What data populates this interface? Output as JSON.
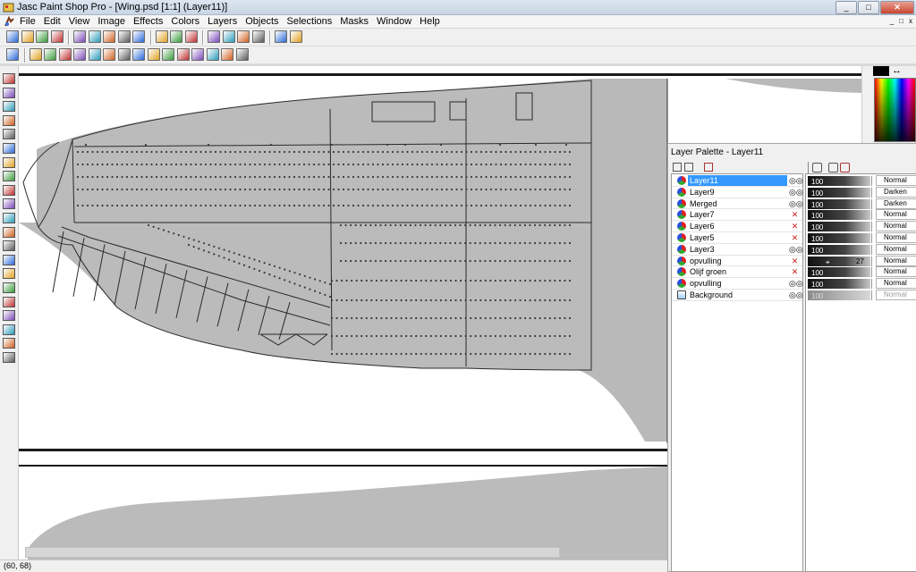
{
  "window": {
    "title": "Jasc Paint Shop Pro - [Wing.psd [1:1] (Layer11)]",
    "controls": [
      "_",
      "□",
      "✕"
    ]
  },
  "menubar": {
    "items": [
      "File",
      "Edit",
      "View",
      "Image",
      "Effects",
      "Colors",
      "Layers",
      "Objects",
      "Selections",
      "Masks",
      "Window",
      "Help"
    ],
    "doc_controls": [
      "_",
      "□",
      "x"
    ]
  },
  "toolbars": {
    "standard_icons": [
      "new-icon",
      "open-icon",
      "save-icon",
      "print-icon",
      "undo-icon",
      "redo-icon",
      "cut-icon",
      "copy-icon",
      "paste-icon",
      "browse-icon",
      "capture-icon",
      "zoom-icon",
      "toggle-palettes-icon",
      "histogram-icon",
      "overview-icon",
      "full-screen-icon",
      "help-icon",
      "context-help-icon"
    ],
    "effects_icons": [
      "effect-1-icon",
      "effect-2-icon",
      "effect-3-icon",
      "effect-4-icon",
      "effect-5-icon",
      "effect-6-icon",
      "effect-7-icon",
      "effect-8-icon",
      "effect-9-icon",
      "effect-10-icon",
      "effect-11-icon",
      "effect-12-icon",
      "effect-13-icon",
      "effect-14-icon",
      "effect-15-icon",
      "effect-16-icon"
    ]
  },
  "toolbox": {
    "tools": [
      "pointer-icon",
      "zoom-tool-icon",
      "deformation-icon",
      "crop-icon",
      "mover-icon",
      "selection-icon",
      "freehand-icon",
      "dropper-icon",
      "paintbrush-icon",
      "clone-icon",
      "color-replacer-icon",
      "retouch-icon",
      "scratch-remover-icon",
      "eraser-icon",
      "picture-tube-icon",
      "airbrush-icon",
      "flood-fill-icon",
      "text-icon",
      "draw-icon",
      "preset-shapes-icon",
      "object-selector-icon"
    ]
  },
  "colors": {
    "foreground": "#000000",
    "swap_label": "↔",
    "canvas_fill": "#b8b8b8",
    "selection": "#3399ff"
  },
  "layer_palette": {
    "title": "Layer Palette - Layer11",
    "layers": [
      {
        "name": "Layer11",
        "visible": true,
        "opacity": "100",
        "blend": "Normal",
        "selected": true
      },
      {
        "name": "Layer9",
        "visible": true,
        "opacity": "100",
        "blend": "Darken"
      },
      {
        "name": "Merged",
        "visible": true,
        "opacity": "100",
        "blend": "Darken"
      },
      {
        "name": "Layer7",
        "visible": false,
        "opacity": "100",
        "blend": "Normal"
      },
      {
        "name": "Layer6",
        "visible": false,
        "opacity": "100",
        "blend": "Normal"
      },
      {
        "name": "Layer5",
        "visible": false,
        "opacity": "100",
        "blend": "Normal"
      },
      {
        "name": "Layer3",
        "visible": true,
        "opacity": "100",
        "blend": "Normal"
      },
      {
        "name": "opvulling",
        "visible": false,
        "opacity": "",
        "opacity_value": "27",
        "blend": "Normal"
      },
      {
        "name": "Olijf groen",
        "visible": false,
        "opacity": "100",
        "blend": "Normal"
      },
      {
        "name": "opvulling",
        "visible": true,
        "opacity": "100",
        "blend": "Normal"
      },
      {
        "name": "Background",
        "visible": true,
        "opacity": "100",
        "blend": "Normal",
        "faded": true
      }
    ]
  },
  "statusbar": {
    "coords": "(60, 68)"
  }
}
